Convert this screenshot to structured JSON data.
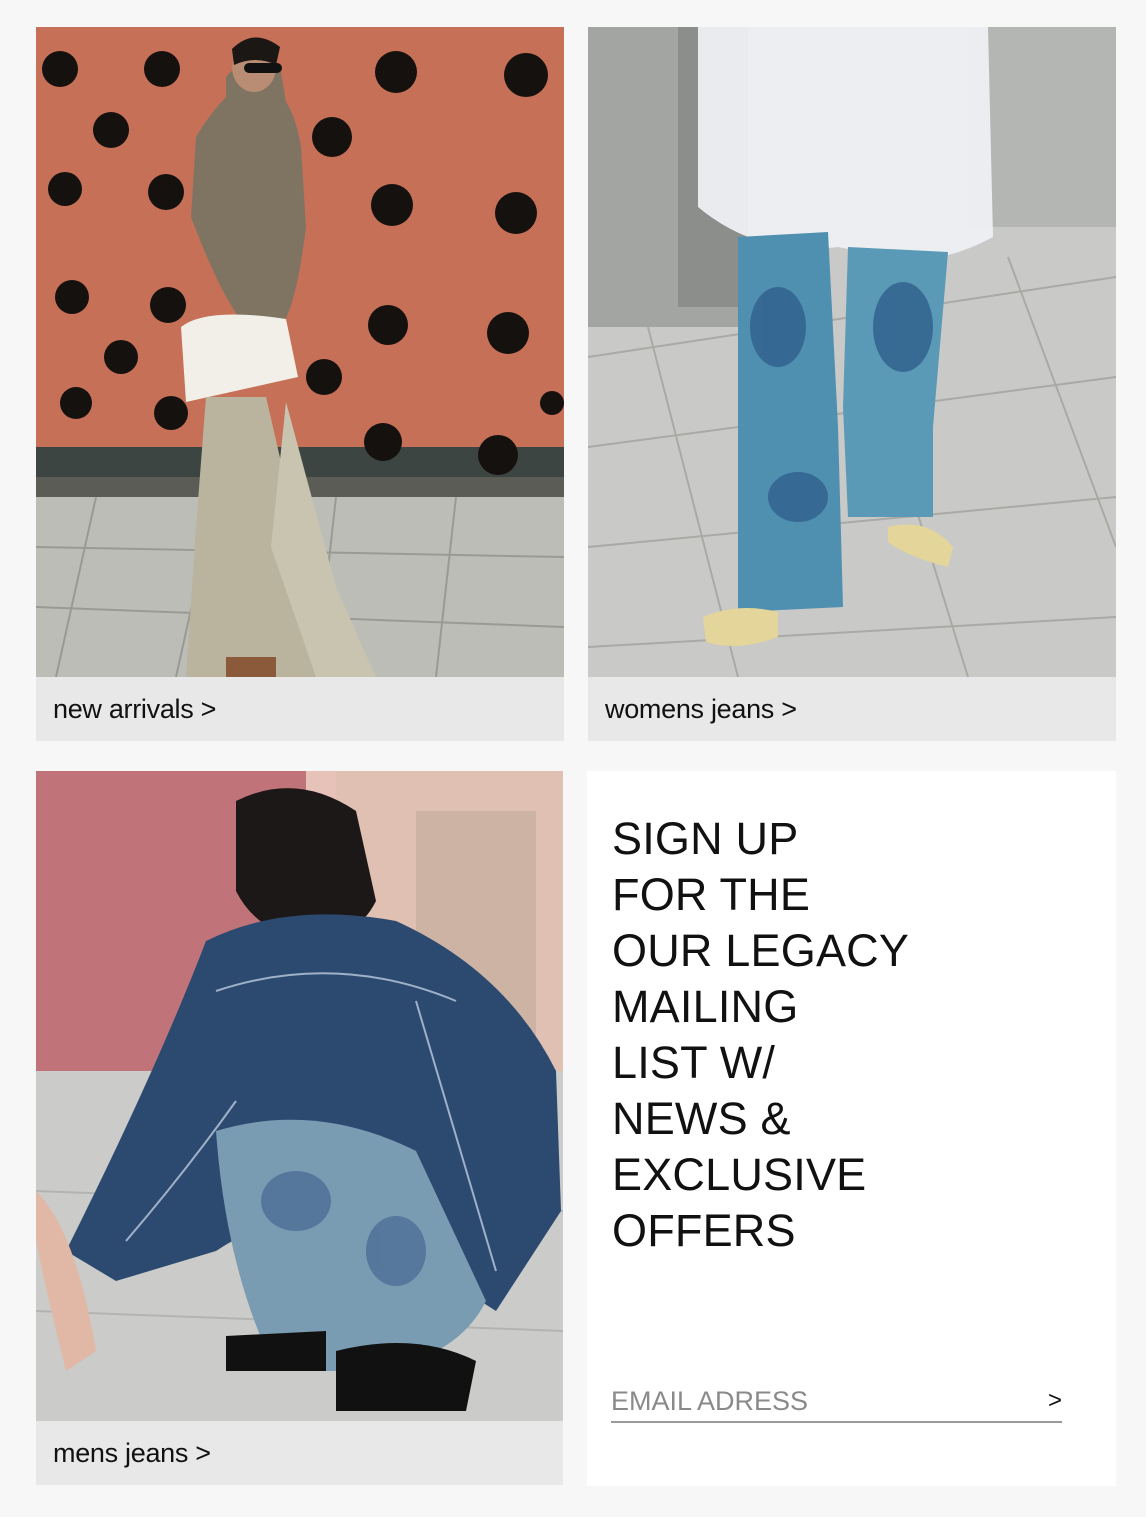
{
  "tiles": [
    {
      "caption": "new arrivals >"
    },
    {
      "caption": "womens jeans >"
    },
    {
      "caption": "mens jeans >"
    }
  ],
  "signup": {
    "heading": "SIGN UP\nFOR THE\nOUR LEGACY\nMAILING\nLIST W/\nNEWS &\nEXCLUSIVE\nOFFERS",
    "email_placeholder": "EMAIL ADRESS",
    "submit_label": ">"
  },
  "colors": {
    "page_bg": "#f7f7f7",
    "caption_bg": "#e8e8e8",
    "panel_bg": "#ffffff",
    "text": "#111111"
  }
}
